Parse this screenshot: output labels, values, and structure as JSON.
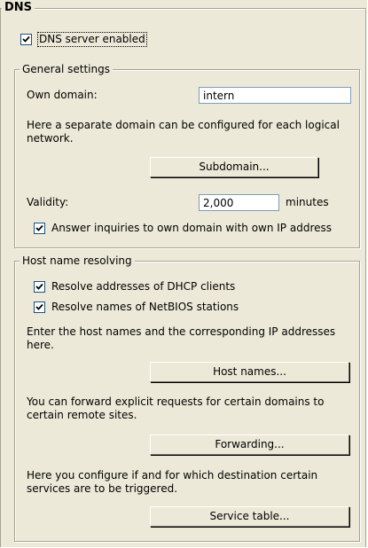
{
  "title": "DNS",
  "dns_enabled": {
    "label": "DNS server enabled",
    "checked": true
  },
  "general": {
    "title": "General settings",
    "own_domain_label": "Own domain:",
    "own_domain_value": "intern",
    "separate_text": "Here a separate domain can be configured for each logical network.",
    "subdomain_button": "Subdomain...",
    "validity_label": "Validity:",
    "validity_value": "2,000",
    "validity_unit": "minutes",
    "answer_label": "Answer inquiries to own domain with own IP address",
    "answer_checked": true
  },
  "resolving": {
    "title": "Host name resolving",
    "dhcp_label": "Resolve addresses of DHCP clients",
    "dhcp_checked": true,
    "netbios_label": "Resolve names of NetBIOS stations",
    "netbios_checked": true,
    "hosts_text": "Enter the host names and the corresponding IP addresses here.",
    "hosts_button": "Host names...",
    "forward_text": "You can forward explicit requests for certain domains to certain remote sites.",
    "forward_button": "Forwarding...",
    "service_text": "Here you configure if and for which destination certain services are to be triggered.",
    "service_button": "Service table..."
  }
}
